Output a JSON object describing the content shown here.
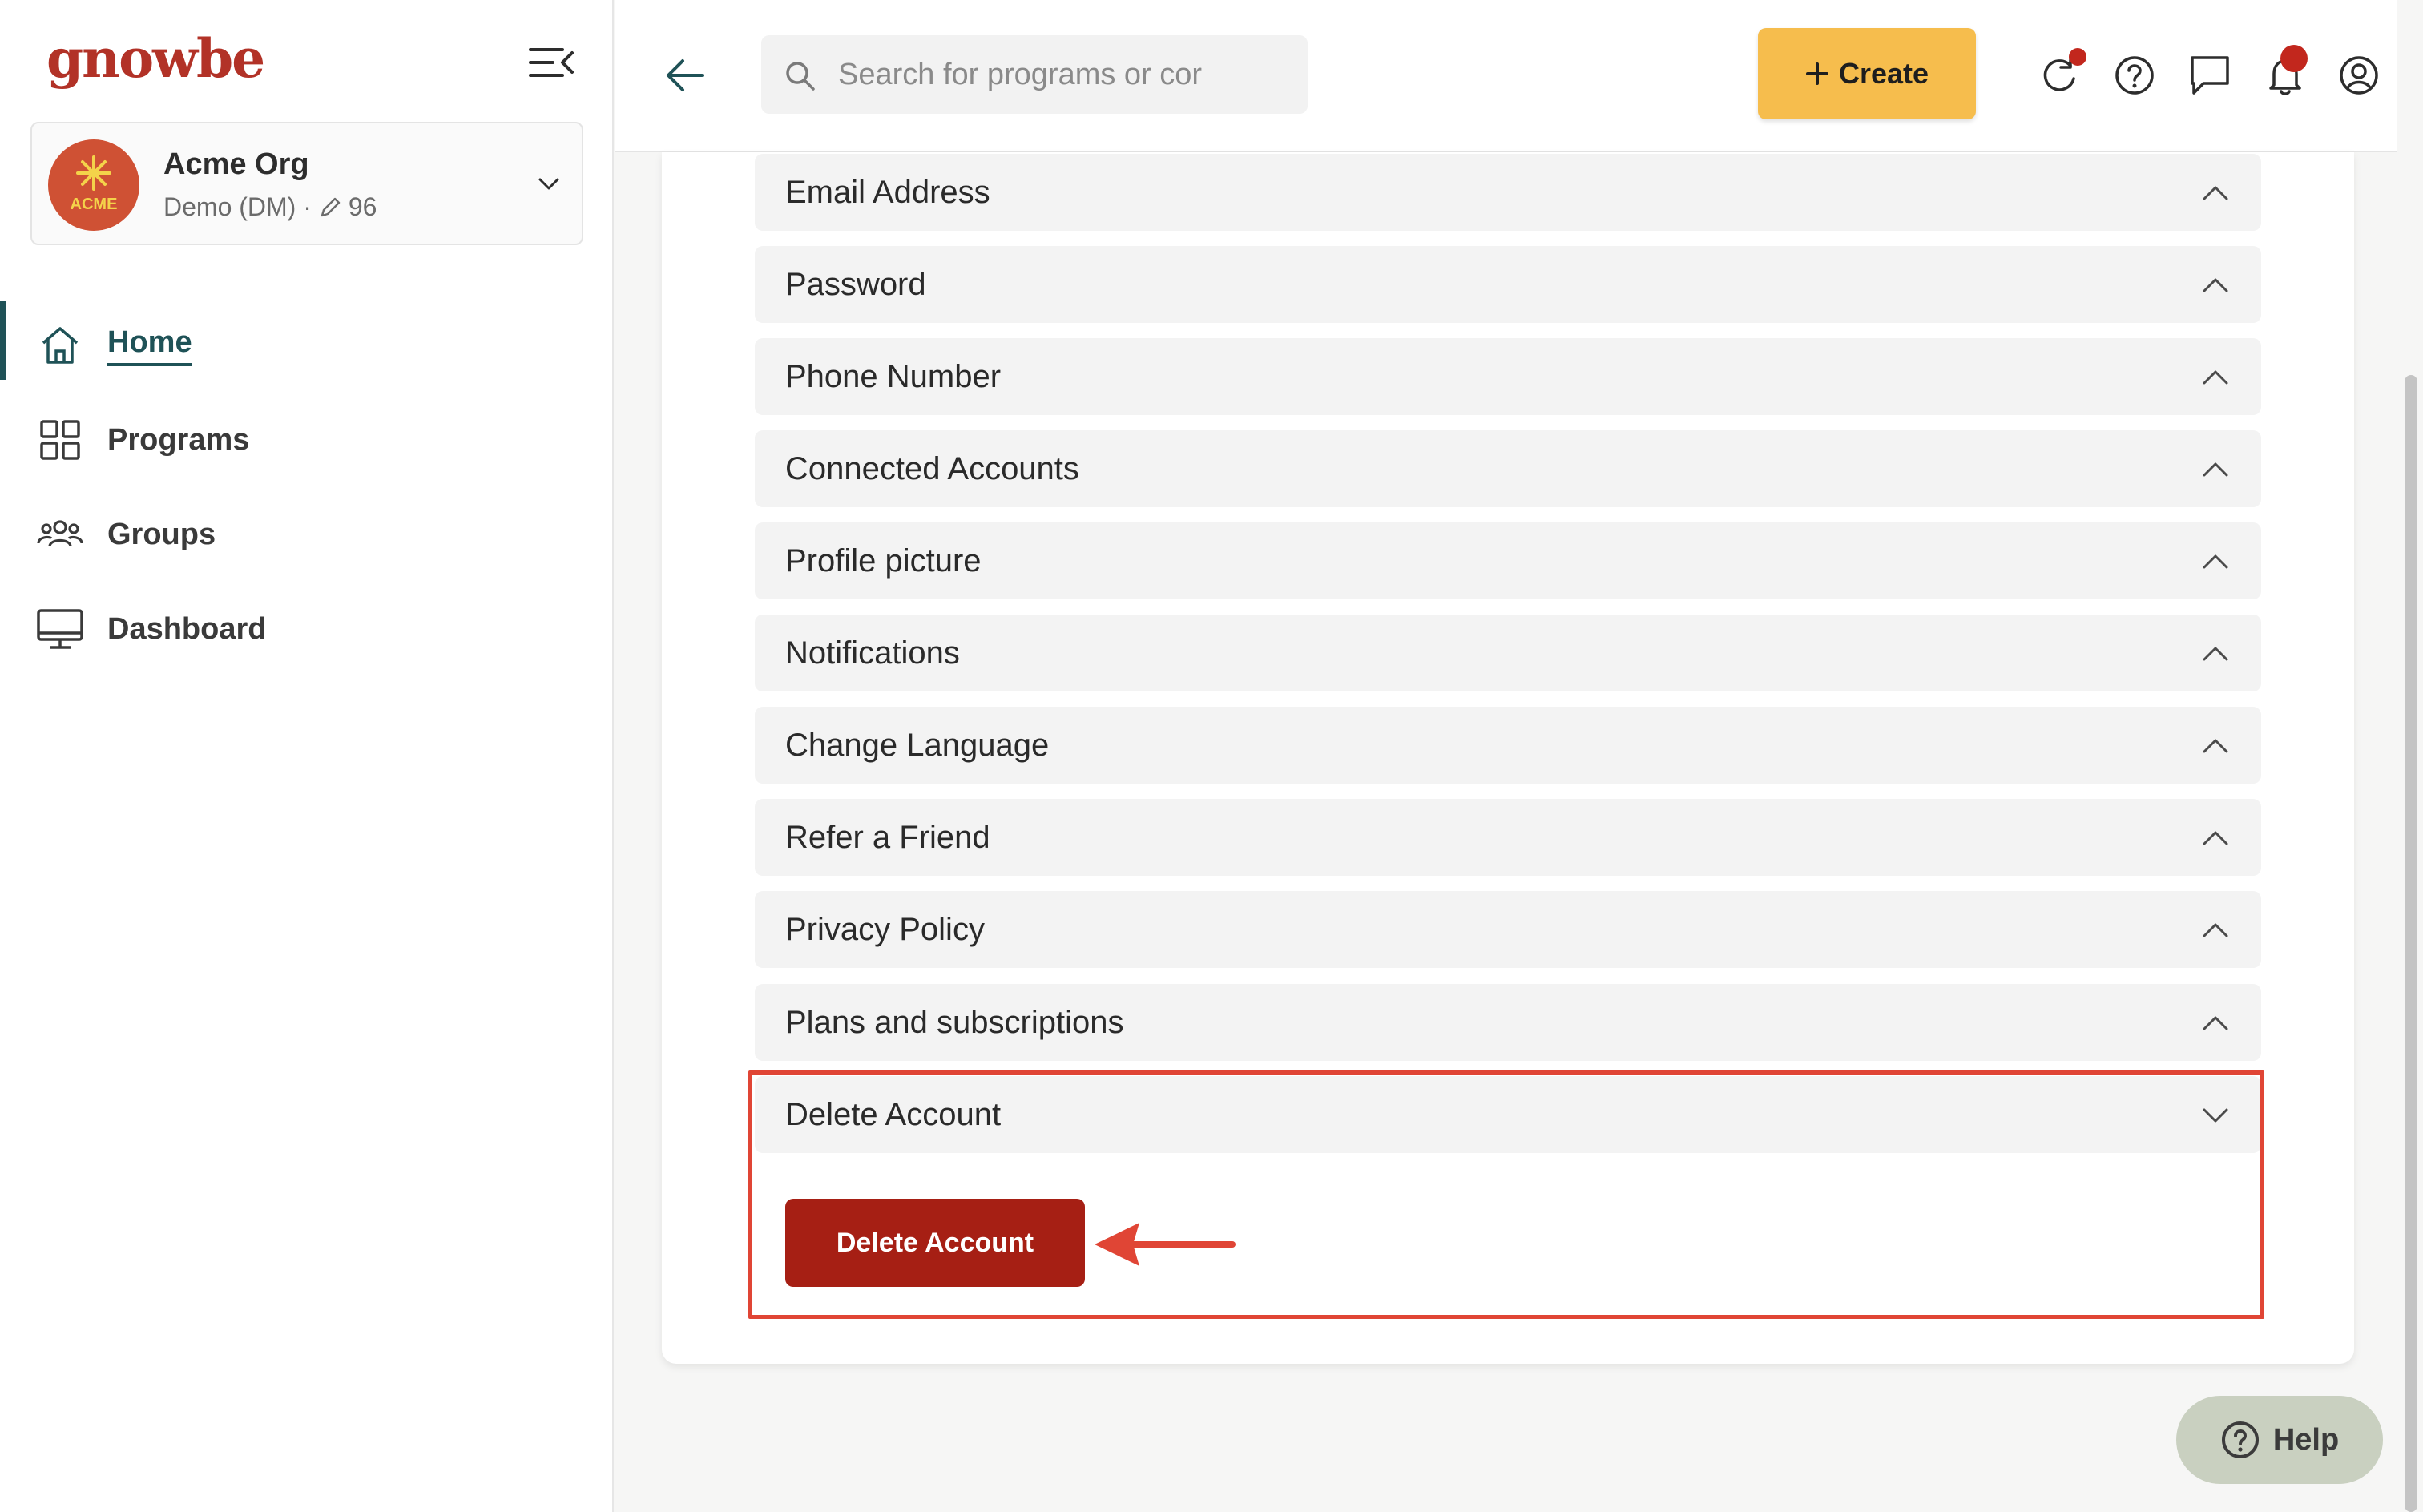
{
  "app": {
    "logo_text": "gnowbe"
  },
  "org": {
    "name": "Acme Org",
    "avatar_text": "ACME",
    "subtitle": "Demo (DM) ·",
    "edit_count": "96"
  },
  "nav": {
    "items": [
      {
        "label": "Home",
        "icon": "home-icon",
        "active": true
      },
      {
        "label": "Programs",
        "icon": "grid-icon",
        "active": false
      },
      {
        "label": "Groups",
        "icon": "users-icon",
        "active": false
      },
      {
        "label": "Dashboard",
        "icon": "monitor-icon",
        "active": false
      }
    ]
  },
  "header": {
    "search_placeholder": "Search for programs or cor",
    "create_label": "Create",
    "icons": [
      "refresh-icon",
      "help-circle-icon",
      "chat-icon",
      "bell-icon",
      "user-circle-icon"
    ]
  },
  "settings": {
    "sections": [
      {
        "label": "Email Address",
        "expanded": false
      },
      {
        "label": "Password",
        "expanded": false
      },
      {
        "label": "Phone Number",
        "expanded": false
      },
      {
        "label": "Connected Accounts",
        "expanded": false
      },
      {
        "label": "Profile picture",
        "expanded": false
      },
      {
        "label": "Notifications",
        "expanded": false
      },
      {
        "label": "Change Language",
        "expanded": false
      },
      {
        "label": "Refer a Friend",
        "expanded": false
      },
      {
        "label": "Privacy Policy",
        "expanded": false
      },
      {
        "label": "Plans and subscriptions",
        "expanded": false
      },
      {
        "label": "Delete Account",
        "expanded": true
      }
    ]
  },
  "delete": {
    "button_label": "Delete Account"
  },
  "help": {
    "label": "Help"
  },
  "colors": {
    "brand": "#b23227",
    "accent": "#f6bd4d",
    "danger": "#a61f14",
    "highlight": "#e04535",
    "nav_active": "#1f5257"
  }
}
